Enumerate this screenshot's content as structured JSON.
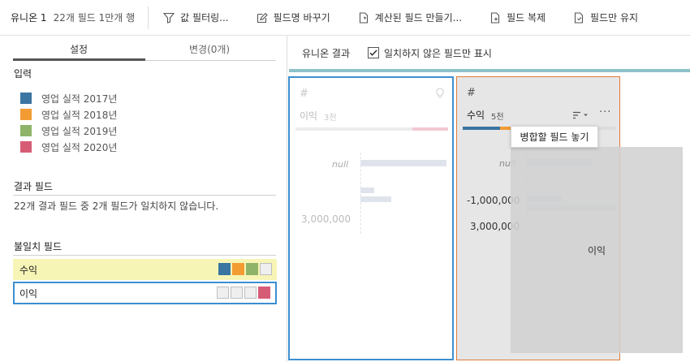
{
  "toolbar": {
    "title": "유니온 1",
    "meta": "22개 필드  1만개 행",
    "buttons": [
      {
        "label": "값 필터링...",
        "icon": "filter-icon"
      },
      {
        "label": "필드명 바꾸기",
        "icon": "rename-icon"
      },
      {
        "label": "계산된 필드 만들기...",
        "icon": "calc-field-icon"
      },
      {
        "label": "필드 복제",
        "icon": "duplicate-icon"
      },
      {
        "label": "필드만 유지",
        "icon": "keep-only-icon"
      }
    ]
  },
  "left": {
    "tabs": {
      "settings": "설정",
      "changes": "변경(0개)"
    },
    "inputs_title": "입력",
    "inputs": [
      {
        "label": "영업 실적 2017년",
        "color": "#3b75a2"
      },
      {
        "label": "영업 실적 2018년",
        "color": "#f39c34"
      },
      {
        "label": "영업 실적 2019년",
        "color": "#8fb369"
      },
      {
        "label": "영업 실적 2020년",
        "color": "#d65c76"
      }
    ],
    "result_title": "결과 필드",
    "result_text": "22개 결과 필드 중 2개 필드가 일치하지 않습니다.",
    "mismatch_title": "불일치 필드",
    "mismatch_fields": [
      {
        "name": "수익",
        "present": [
          true,
          true,
          true,
          false
        ]
      },
      {
        "name": "이익",
        "present": [
          false,
          false,
          false,
          true
        ]
      }
    ]
  },
  "right": {
    "title": "유니온 결과",
    "checkbox_label": "일치하지 않은 필드만 표시",
    "checkbox_checked": true,
    "card1": {
      "hash": "#",
      "name": "이익",
      "count": "3천",
      "null_label": "null",
      "axis_label": "3,000,000"
    },
    "card2": {
      "hash": "#",
      "name": "수익",
      "count": "5천",
      "null_label": "null",
      "axis_top": "-1,000,000",
      "axis_bottom": "3,000,000",
      "more": "···"
    },
    "tooltip": "병합할 필드 놓기",
    "drag_label": "이익"
  }
}
